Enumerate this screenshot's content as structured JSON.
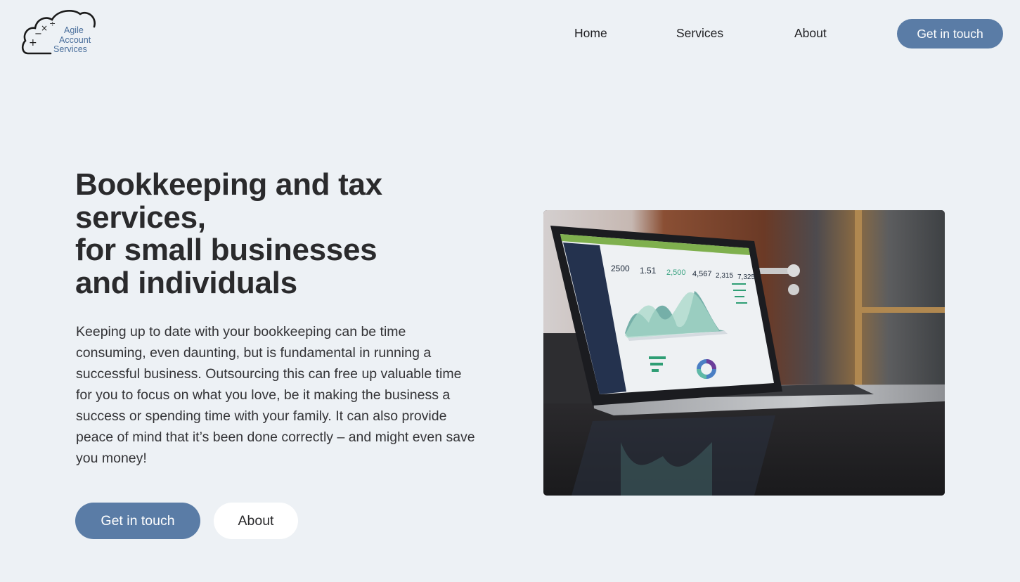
{
  "brand": {
    "name_lines": [
      "Agile",
      "Account",
      "Services"
    ],
    "logo_icon": "cloud-calculator-icon",
    "accent_color": "#5a7ca6",
    "background_color": "#edf1f5"
  },
  "nav": {
    "items": [
      {
        "label": "Home"
      },
      {
        "label": "Services"
      },
      {
        "label": "About"
      }
    ],
    "cta_label": "Get in touch"
  },
  "hero": {
    "title_lines": [
      "Bookkeeping and tax",
      "services,",
      "for small businesses",
      "and individuals"
    ],
    "description": "Keeping up to date with your bookkeeping can be time consuming, even daunting, but is fundamental in running a successful business. Outsourcing this can free up valuable time for you to focus on what you love, be it making the business a success or spending time with your family. It can also provide peace of mind that it’s been done correctly – and might even save you money!",
    "primary_button": "Get in touch",
    "secondary_button": "About",
    "image": {
      "description": "Laptop on reflective desk displaying an analytics dashboard",
      "screen_stats": [
        "2500",
        "1.51",
        "2,500",
        "4,567",
        "2,315",
        "7,325"
      ]
    }
  }
}
